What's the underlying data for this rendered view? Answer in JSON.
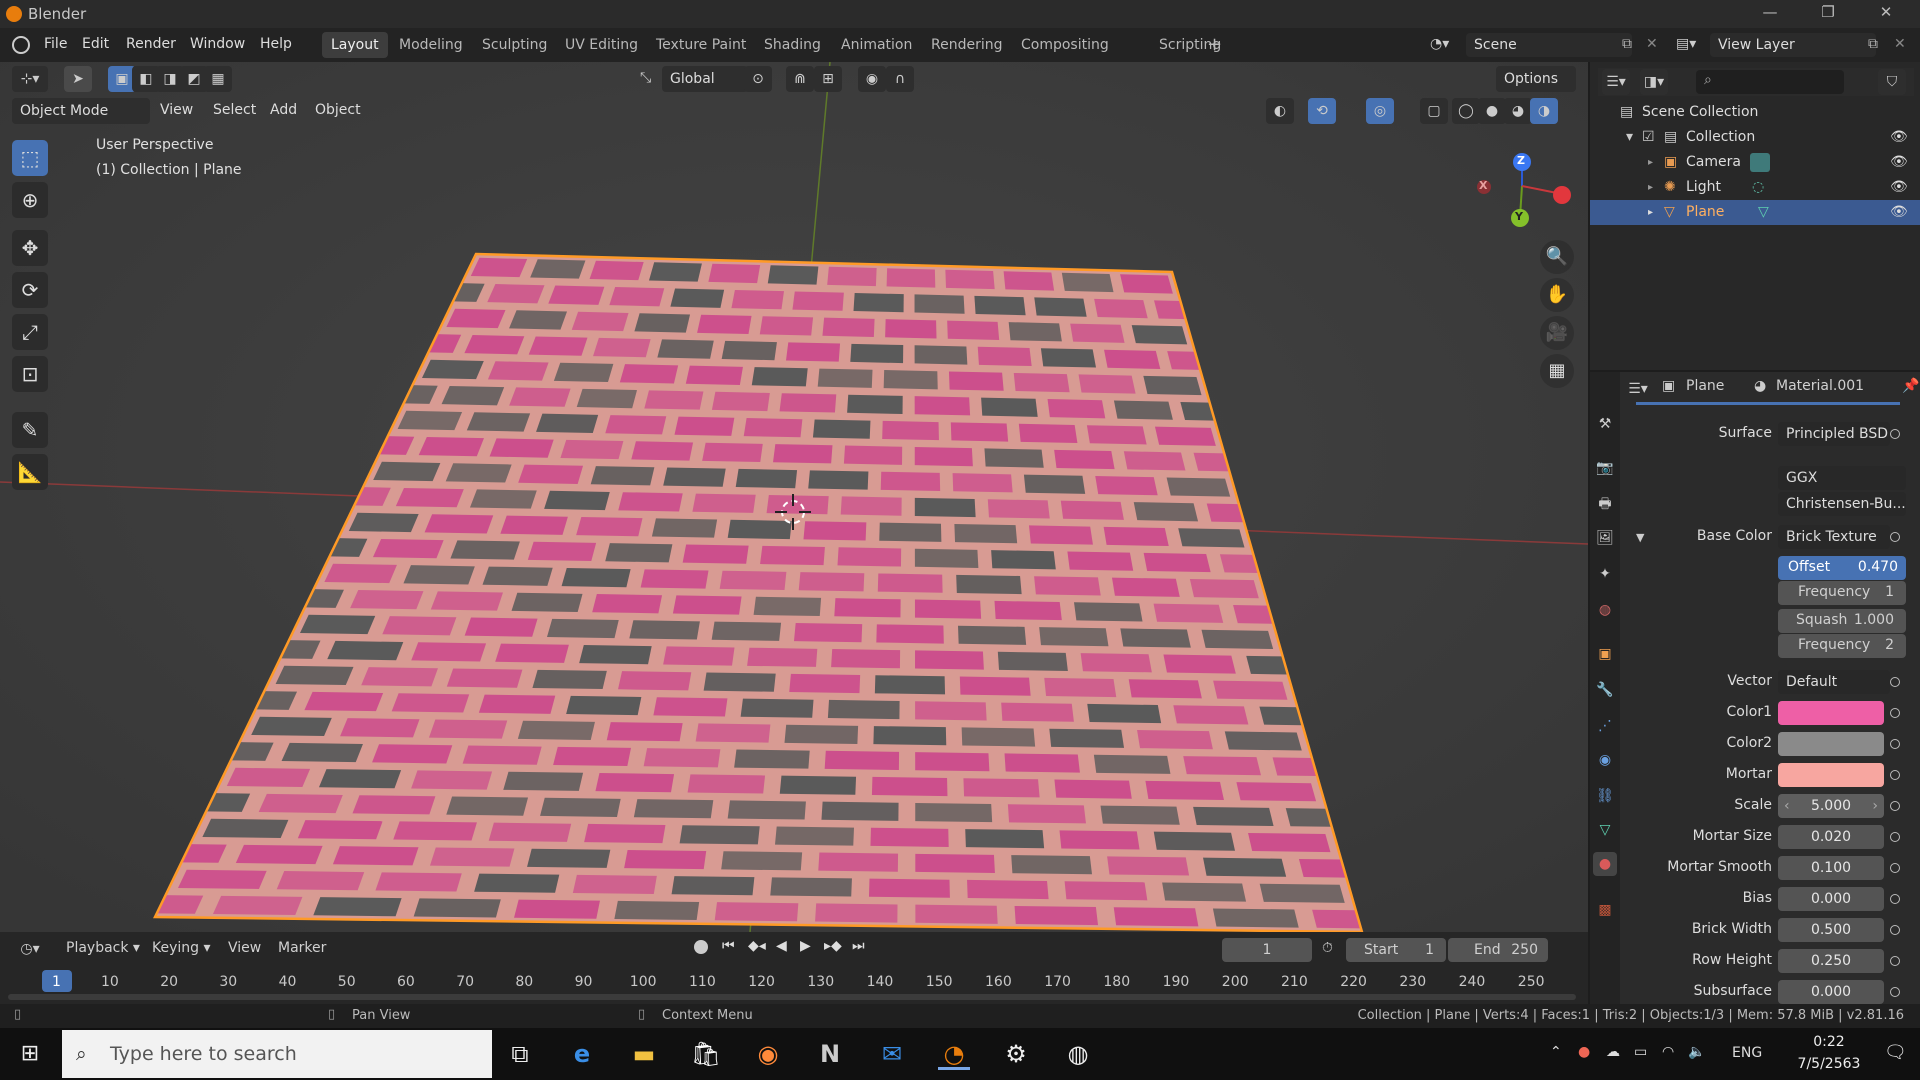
{
  "window": {
    "title": "Blender",
    "minimize": "—",
    "restore": "❐",
    "close": "✕"
  },
  "menu": {
    "items": [
      "File",
      "Edit",
      "Render",
      "Window",
      "Help"
    ]
  },
  "workspaces": {
    "tabs": [
      "Layout",
      "Modeling",
      "Sculpting",
      "UV Editing",
      "Texture Paint",
      "Shading",
      "Animation",
      "Rendering",
      "Compositing",
      "Scripting"
    ],
    "active": "Layout",
    "add": "+"
  },
  "scene": {
    "name": "Scene",
    "view_layer": "View Layer"
  },
  "viewport": {
    "mode": "Object Mode",
    "menus": [
      "View",
      "Select",
      "Add",
      "Object"
    ],
    "transform_orientation": "Global",
    "options": "Options",
    "info_line1": "User Perspective",
    "info_line2": "(1) Collection | Plane",
    "gizmo": {
      "z": "Z",
      "y": "Y",
      "x": "X"
    },
    "colors": {
      "background": "#3a3a3a",
      "plane_pink": "#cc4f8c",
      "plane_gray": "#5a5a5a",
      "mortar": "#d89b93",
      "outline": "#ff9a26"
    }
  },
  "outliner": {
    "root": "Scene Collection",
    "items": [
      {
        "label": "Collection",
        "level": 1
      },
      {
        "label": "Camera",
        "level": 2
      },
      {
        "label": "Light",
        "level": 2
      },
      {
        "label": "Plane",
        "level": 2,
        "selected": true
      }
    ]
  },
  "properties": {
    "object": "Plane",
    "material": "Material.001",
    "rows": {
      "surface": {
        "label": "Surface",
        "value": "Principled BSD"
      },
      "distribution": "GGX",
      "subsurface_method": "Christensen-Bu...",
      "base_color": {
        "label": "Base Color",
        "value": "Brick Texture"
      },
      "offset": {
        "label": "Offset",
        "value": "0.470"
      },
      "offset_frequency": {
        "label": "Frequency",
        "value": "1"
      },
      "squash": {
        "label": "Squash",
        "value": "1.000"
      },
      "squash_frequency": {
        "label": "Frequency",
        "value": "2"
      },
      "vector": {
        "label": "Vector",
        "value": "Default"
      },
      "color1": {
        "label": "Color1",
        "color": "#ee5fa6"
      },
      "color2": {
        "label": "Color2",
        "color": "#8a8a8a"
      },
      "mortar": {
        "label": "Mortar",
        "color": "#f7a6a0"
      },
      "scale": {
        "label": "Scale",
        "value": "5.000"
      },
      "mortar_size": {
        "label": "Mortar Size",
        "value": "0.020"
      },
      "mortar_smooth": {
        "label": "Mortar Smooth",
        "value": "0.100"
      },
      "bias": {
        "label": "Bias",
        "value": "0.000"
      },
      "brick_width": {
        "label": "Brick Width",
        "value": "0.500"
      },
      "row_height": {
        "label": "Row Height",
        "value": "0.250"
      },
      "subsurface": {
        "label": "Subsurface",
        "value": "0.000"
      }
    }
  },
  "timeline": {
    "menus": [
      "Playback",
      "Keying",
      "View",
      "Marker"
    ],
    "current_frame": "1",
    "start_label": "Start",
    "start": "1",
    "end_label": "End",
    "end": "250",
    "ticks": [
      "1",
      "10",
      "20",
      "30",
      "40",
      "50",
      "60",
      "70",
      "80",
      "90",
      "100",
      "110",
      "120",
      "130",
      "140",
      "150",
      "160",
      "170",
      "180",
      "190",
      "200",
      "210",
      "220",
      "230",
      "240",
      "250"
    ]
  },
  "status": {
    "left": "Pan View",
    "middle": "Context Menu",
    "right": "Collection | Plane | Verts:4 | Faces:1 | Tris:2 | Objects:1/3 | Mem: 57.8 MiB | v2.81.16"
  },
  "taskbar": {
    "search_placeholder": "Type here to search",
    "language": "ENG",
    "time": "0:22",
    "date": "7/5/2563"
  }
}
